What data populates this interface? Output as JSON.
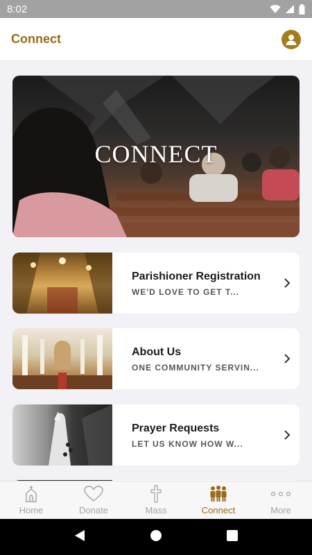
{
  "status_bar": {
    "time": "8:02"
  },
  "app_bar": {
    "title": "Connect"
  },
  "hero": {
    "title": "CONNECT"
  },
  "cards": [
    {
      "title": "Parishioner Registration",
      "subtitle": "WE'D LOVE TO GET T..."
    },
    {
      "title": "About Us",
      "subtitle": "ONE COMMUNITY SERVIN..."
    },
    {
      "title": "Prayer Requests",
      "subtitle": "LET US KNOW HOW W..."
    }
  ],
  "bottom_nav": [
    {
      "label": "Home",
      "icon": "church-icon"
    },
    {
      "label": "Donate",
      "icon": "heart-icon"
    },
    {
      "label": "Mass",
      "icon": "cross-icon"
    },
    {
      "label": "Connect",
      "icon": "people-icon",
      "active": true
    },
    {
      "label": "More",
      "icon": "more-icon"
    }
  ],
  "colors": {
    "accent": "#9a6a16",
    "inactive": "#a4a4a4"
  }
}
